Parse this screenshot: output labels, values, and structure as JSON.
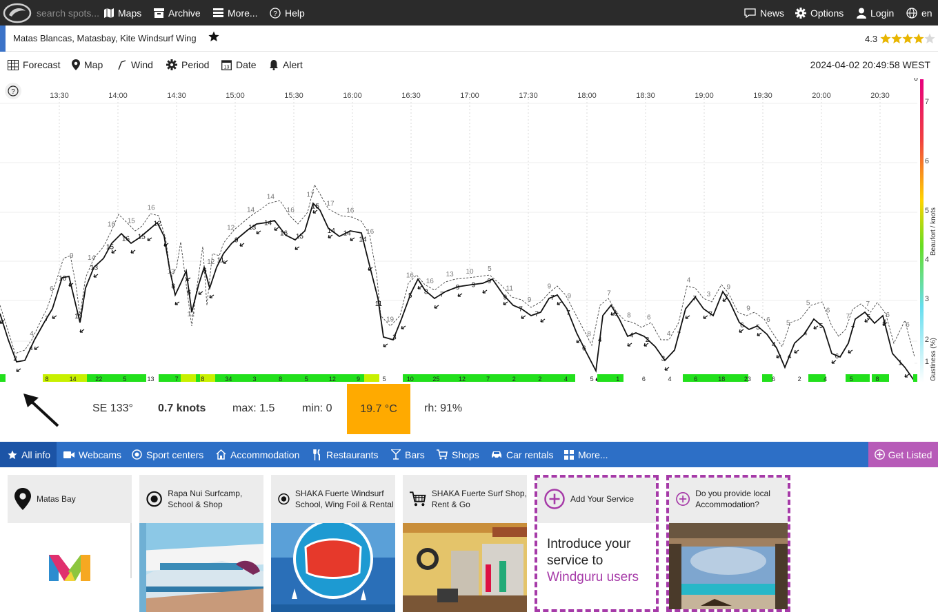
{
  "topbar": {
    "search_placeholder": "search spots...",
    "menu": [
      "Maps",
      "Archive",
      "More...",
      "Help"
    ],
    "right": [
      "News",
      "Options",
      "Login",
      "en"
    ]
  },
  "spot": {
    "name": "Matas Blancas, Matasbay, Kite Windsurf Wing",
    "rating": "4.3",
    "stars": 4.3
  },
  "toolbar": {
    "items": [
      "Forecast",
      "Map",
      "Wind",
      "Period",
      "Date",
      "Alert"
    ],
    "datetime": "2024-04-02 20:49:58 WEST"
  },
  "graph": {
    "time_ticks": [
      "13:30",
      "14:00",
      "14:30",
      "15:00",
      "15:30",
      "16:00",
      "16:30",
      "17:00",
      "17:30",
      "18:00",
      "18:30",
      "19:00",
      "19:30",
      "20:00",
      "20:30"
    ],
    "beaufort_ticks": [
      "7",
      "6",
      "5",
      "4",
      "3",
      "2",
      "1"
    ],
    "axis_label": "Beaufort / knots",
    "gust_label": "Gustiness (%)",
    "avg_labels": [
      "2",
      "4",
      "7",
      "10",
      "10",
      "13",
      "15",
      "16",
      "15",
      "12",
      "8",
      "6",
      "6",
      "11",
      "9",
      "13",
      "14",
      "16",
      "15",
      "15",
      "14",
      "14",
      "14",
      "11",
      "3",
      "5",
      "8",
      "7",
      "9",
      "9",
      "9",
      "9",
      "7",
      "7",
      "7",
      "7",
      "6",
      "4",
      "6",
      "4",
      "2",
      "3",
      "7",
      "7",
      "7",
      "7",
      "6",
      "5",
      "4",
      "4",
      "4",
      "5",
      "6",
      "7",
      "5",
      "4",
      "1",
      "0"
    ],
    "gust_labels": [
      "4",
      "6",
      "9",
      "14",
      "16",
      "15",
      "16",
      "13",
      "12",
      "12",
      "12",
      "14",
      "14",
      "16",
      "17",
      "17",
      "16",
      "16",
      "19",
      "16",
      "16",
      "13",
      "10",
      "5",
      "11",
      "9",
      "9",
      "9",
      "8",
      "7",
      "8",
      "6",
      "4",
      "4",
      "3",
      "9",
      "9",
      "6",
      "5",
      "5",
      "6",
      "7",
      "7",
      "6",
      "6"
    ],
    "gust_strip": [
      "8",
      "14",
      "22",
      "5",
      "13",
      "7",
      "8",
      "34",
      "3",
      "8",
      "5",
      "12",
      "9",
      "5",
      "10",
      "25",
      "12",
      "7",
      "2",
      "2",
      "4",
      "5",
      "1",
      "6",
      "4",
      "6",
      "18",
      "23",
      "6",
      "2",
      "4",
      "5",
      "8"
    ]
  },
  "current": {
    "direction": "SE 133°",
    "speed": "0.7 knots",
    "max": "max: 1.5",
    "min": "min: 0",
    "temp": "19.7 °C",
    "rh": "rh: 91%"
  },
  "nav2": {
    "items": [
      "All info",
      "Webcams",
      "Sport centers",
      "Accommodation",
      "Restaurants",
      "Bars",
      "Shops",
      "Car rentals",
      "More..."
    ],
    "get_listed": "Get Listed"
  },
  "cards": [
    {
      "title": "Matas Bay"
    },
    {
      "title": "Rapa Nui Surfcamp, School & Shop"
    },
    {
      "title": "SHAKA Fuerte Windsurf School, Wing Foil & Rental"
    },
    {
      "title": "SHAKA Fuerte Surf Shop, Rent & Go"
    },
    {
      "title": "Add Your Service",
      "text1": "Introduce your service to",
      "text2": "Windguru users"
    },
    {
      "title": "Do you provide local Accommodation?"
    }
  ],
  "colors": {
    "topbar": "#2b2b2b",
    "nav": "#2d6fc6",
    "accent_purple": "#a63aa8",
    "temp_bg": "#ffaa00"
  }
}
